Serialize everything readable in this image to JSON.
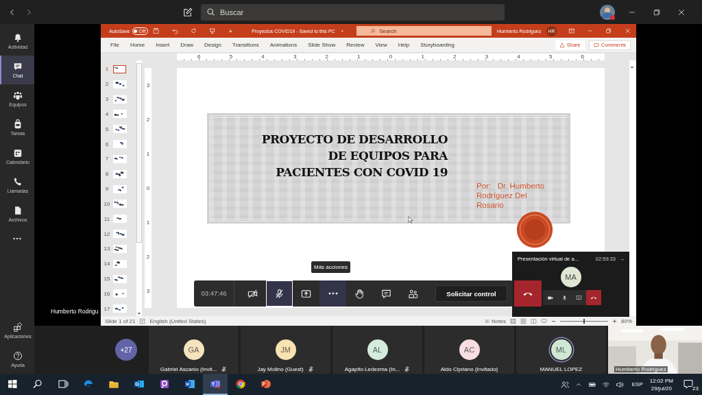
{
  "top_bar": {
    "search": {
      "placeholder": "Buscar"
    }
  },
  "rail": {
    "items": [
      {
        "label": "Actividad",
        "kind": "bell",
        "selected": false
      },
      {
        "label": "Chat",
        "kind": "chat",
        "selected": true
      },
      {
        "label": "Equipos",
        "kind": "teams",
        "selected": false
      },
      {
        "label": "Tareas",
        "kind": "tasks",
        "selected": false
      },
      {
        "label": "Calendario",
        "kind": "calendar",
        "selected": false
      },
      {
        "label": "Llamadas",
        "kind": "phone",
        "selected": false
      },
      {
        "label": "Archivos",
        "kind": "file",
        "selected": false
      }
    ],
    "bottom_items": [
      {
        "label": "Aplicaciones",
        "kind": "apps"
      },
      {
        "label": "Ayuda",
        "kind": "help"
      }
    ]
  },
  "stage": {
    "presenter_label": "Humberto Rodrigu"
  },
  "powerpoint": {
    "autosave": {
      "label": "AutoSave",
      "on": false,
      "state_text": "Off"
    },
    "file_title": "Proyectos COVID19  -  Saved to this PC",
    "search": {
      "placeholder": "Search"
    },
    "user": "Humberto Rodriguez",
    "user_initials": "HR",
    "tabs": [
      "File",
      "Home",
      "Insert",
      "Draw",
      "Design",
      "Transitions",
      "Animations",
      "Slide Show",
      "Review",
      "View",
      "Help",
      "Storyboarding"
    ],
    "share": "Share",
    "comments": "Comments",
    "ruler": [
      "6",
      "5",
      "4",
      "3",
      "2",
      "1",
      "0",
      "1",
      "2",
      "3",
      "4",
      "5",
      "6"
    ],
    "vertical_ruler": [
      "3",
      "2",
      "1",
      "0",
      "1",
      "2",
      "3"
    ],
    "thumbnails": [
      {
        "number": "1",
        "selected": true
      },
      {
        "number": "2",
        "selected": false
      },
      {
        "number": "3",
        "selected": false
      },
      {
        "number": "4",
        "selected": false
      },
      {
        "number": "5",
        "selected": false
      },
      {
        "number": "6",
        "selected": false
      },
      {
        "number": "7",
        "selected": false
      },
      {
        "number": "8",
        "selected": false
      },
      {
        "number": "9",
        "selected": false
      },
      {
        "number": "10",
        "selected": false
      },
      {
        "number": "11",
        "selected": false
      },
      {
        "number": "12",
        "selected": false
      },
      {
        "number": "13",
        "selected": false
      },
      {
        "number": "14",
        "selected": false
      },
      {
        "number": "15",
        "selected": false
      },
      {
        "number": "16",
        "selected": false
      },
      {
        "number": "17",
        "selected": false
      }
    ],
    "slide": {
      "title_lines": [
        "PROYECTO DE DESARROLLO",
        "DE EQUIPOS PARA",
        "PACIENTES CON COVID 19"
      ],
      "author": "Por:   Dr. Humberto Rodríguez Del Rosario"
    },
    "status": {
      "slide": "Slide 1 of 21",
      "language": "English (United States)",
      "notes": "Notes",
      "zoom": "80%",
      "zoom_slider": {
        "level": 0.5
      }
    }
  },
  "call_bar": {
    "timer": "03:47:46",
    "buttons": [
      {
        "kind": "camera-off",
        "outlined": false,
        "highlighted": false
      },
      {
        "kind": "mic-off",
        "outlined": true,
        "highlighted": false
      },
      {
        "kind": "share",
        "outlined": false,
        "highlighted": false
      },
      {
        "kind": "more",
        "outlined": false,
        "highlighted": true
      },
      {
        "kind": "hand",
        "outlined": false,
        "highlighted": false
      },
      {
        "kind": "chat",
        "outlined": false,
        "highlighted": false
      },
      {
        "kind": "people",
        "outlined": false,
        "highlighted": false
      }
    ],
    "request_control": "Solicitar control",
    "tooltip": "Más acciones"
  },
  "mini_window": {
    "title": "Presentación virtual de a...",
    "time": "02:59:33",
    "initials": "MA"
  },
  "participants": {
    "overflow": "+27",
    "tiles": [
      {
        "initials": "GA",
        "name": "Gabriel Ascanio (Invit...",
        "color": "#f5e3bd",
        "muted": true,
        "speaking": false
      },
      {
        "initials": "JM",
        "name": "Jay Molino (Guest)",
        "color": "#f7e2b0",
        "muted": true,
        "speaking": false
      },
      {
        "initials": "AL",
        "name": "Agapito Ledezma (In...",
        "color": "#d5ecdc",
        "muted": true,
        "speaking": false
      },
      {
        "initials": "AC",
        "name": "Aldo Cipriano (Invitado)",
        "color": "#f8dde2",
        "muted": false,
        "speaking": false
      },
      {
        "initials": "ML",
        "name": "MANUEL LOPEZ",
        "color": "#cfe8d4",
        "muted": false,
        "speaking": true
      }
    ],
    "video_name": "Humberto Rodriguez"
  },
  "taskbar": {
    "apps": [
      {
        "kind": "start",
        "active": false
      },
      {
        "kind": "search",
        "active": false
      },
      {
        "kind": "taskview",
        "active": false
      },
      {
        "kind": "edge",
        "active": false
      },
      {
        "kind": "folder",
        "active": false
      },
      {
        "kind": "mail",
        "active": false
      },
      {
        "kind": "purple",
        "active": false
      },
      {
        "kind": "word",
        "active": false
      },
      {
        "kind": "teams",
        "active": true
      },
      {
        "kind": "chrome",
        "active": false
      },
      {
        "kind": "ppt",
        "active": false
      }
    ],
    "language": "ESP",
    "time": "12:02 PM",
    "date": "29/jul/20",
    "notifications": "23"
  }
}
